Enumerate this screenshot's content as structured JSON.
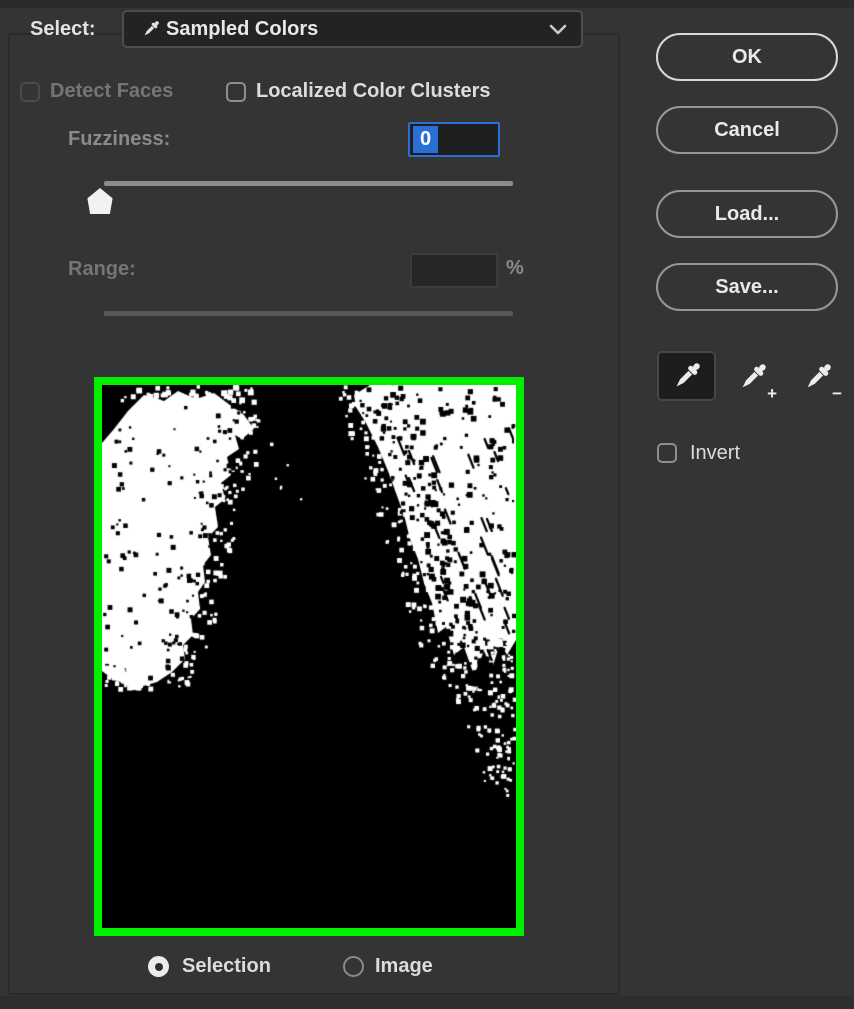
{
  "dialog": {
    "select_label": "Select:",
    "select_value": "Sampled Colors",
    "detect_faces_label": "Detect Faces",
    "localized_label": "Localized Color Clusters",
    "fuzziness": {
      "label": "Fuzziness:",
      "value": "0"
    },
    "range": {
      "label": "Range:",
      "value": "",
      "unit": "%"
    },
    "invert_label": "Invert",
    "modes": [
      {
        "label": "Selection",
        "selected": true
      },
      {
        "label": "Image",
        "selected": false
      }
    ],
    "buttons": {
      "ok": "OK",
      "cancel": "Cancel",
      "load": "Load...",
      "save": "Save..."
    },
    "tools": [
      {
        "name": "eyedropper",
        "selected": true
      },
      {
        "name": "add-to-sample",
        "badge": "+"
      },
      {
        "name": "subtract-from-sample",
        "badge": "−"
      }
    ]
  },
  "colors": {
    "accent_blue": "#2a6fd6",
    "preview_border": "#00f000",
    "mask_foreground": "#ffffff",
    "mask_background": "#000000",
    "dialog_background": "#343434"
  }
}
